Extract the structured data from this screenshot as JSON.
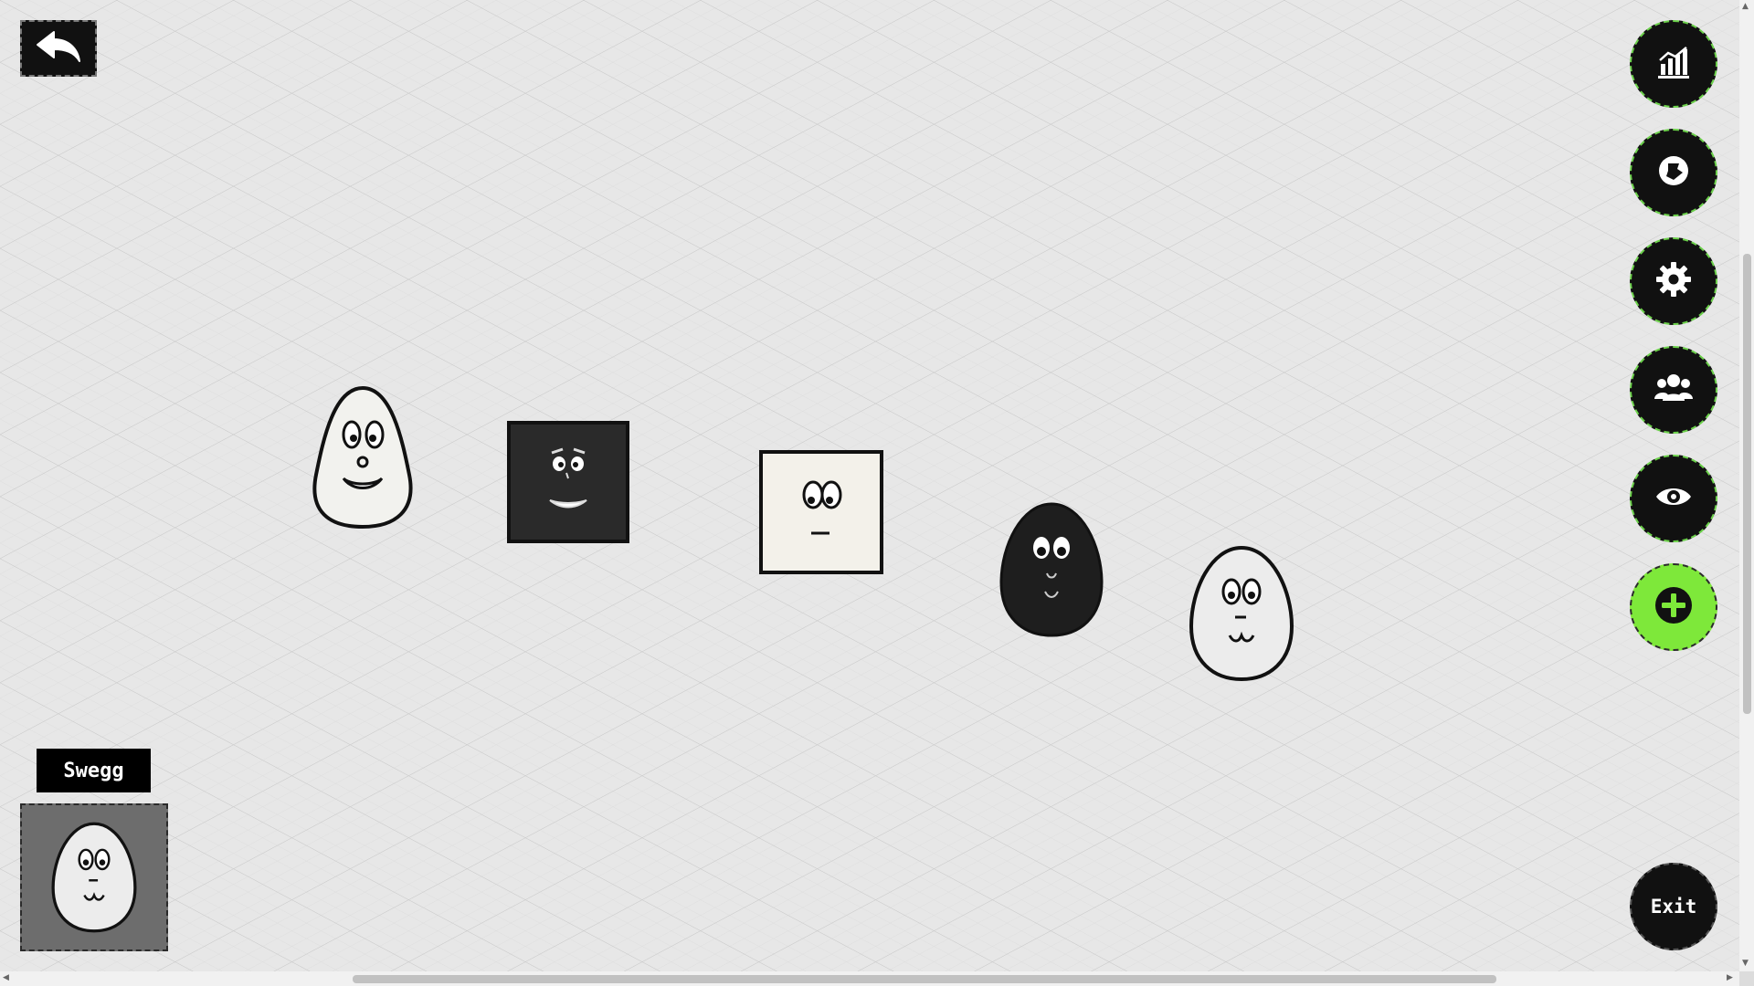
{
  "nav": {
    "back_icon": "back-arrow-icon"
  },
  "sidebar": {
    "buttons": [
      {
        "name": "stats-button",
        "icon": "bar-chart-icon"
      },
      {
        "name": "puzzle-button",
        "icon": "puzzle-badge-icon"
      },
      {
        "name": "settings-button",
        "icon": "gear-icon"
      },
      {
        "name": "group-button",
        "icon": "users-icon"
      },
      {
        "name": "view-button",
        "icon": "eye-icon"
      },
      {
        "name": "add-button",
        "icon": "plus-circle-icon"
      }
    ],
    "exit_label": "Exit"
  },
  "selected": {
    "name": "Swegg",
    "character": "white-egg-character"
  },
  "characters": [
    {
      "name": "white-blob-character",
      "shape": "egg",
      "color": "#f2f2ee"
    },
    {
      "name": "black-square-character",
      "shape": "square",
      "color": "#2a2a2a"
    },
    {
      "name": "white-square-character",
      "shape": "square",
      "color": "#f3f1ea"
    },
    {
      "name": "black-egg-character",
      "shape": "egg",
      "color": "#1e1e1e"
    },
    {
      "name": "white-egg-character",
      "shape": "egg",
      "color": "#ececec"
    }
  ],
  "colors": {
    "accent": "#7ee83a",
    "button_bg": "#111111"
  }
}
